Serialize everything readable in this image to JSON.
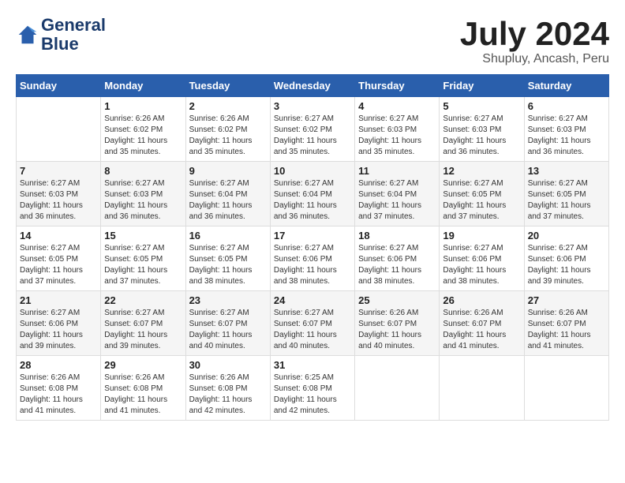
{
  "header": {
    "logo_line1": "General",
    "logo_line2": "Blue",
    "month_title": "July 2024",
    "subtitle": "Shupluy, Ancash, Peru"
  },
  "days_of_week": [
    "Sunday",
    "Monday",
    "Tuesday",
    "Wednesday",
    "Thursday",
    "Friday",
    "Saturday"
  ],
  "weeks": [
    [
      {
        "day": "",
        "sunrise": "",
        "sunset": "",
        "daylight": ""
      },
      {
        "day": "1",
        "sunrise": "Sunrise: 6:26 AM",
        "sunset": "Sunset: 6:02 PM",
        "daylight": "Daylight: 11 hours and 35 minutes."
      },
      {
        "day": "2",
        "sunrise": "Sunrise: 6:26 AM",
        "sunset": "Sunset: 6:02 PM",
        "daylight": "Daylight: 11 hours and 35 minutes."
      },
      {
        "day": "3",
        "sunrise": "Sunrise: 6:27 AM",
        "sunset": "Sunset: 6:02 PM",
        "daylight": "Daylight: 11 hours and 35 minutes."
      },
      {
        "day": "4",
        "sunrise": "Sunrise: 6:27 AM",
        "sunset": "Sunset: 6:03 PM",
        "daylight": "Daylight: 11 hours and 35 minutes."
      },
      {
        "day": "5",
        "sunrise": "Sunrise: 6:27 AM",
        "sunset": "Sunset: 6:03 PM",
        "daylight": "Daylight: 11 hours and 36 minutes."
      },
      {
        "day": "6",
        "sunrise": "Sunrise: 6:27 AM",
        "sunset": "Sunset: 6:03 PM",
        "daylight": "Daylight: 11 hours and 36 minutes."
      }
    ],
    [
      {
        "day": "7",
        "sunrise": "Sunrise: 6:27 AM",
        "sunset": "Sunset: 6:03 PM",
        "daylight": "Daylight: 11 hours and 36 minutes."
      },
      {
        "day": "8",
        "sunrise": "Sunrise: 6:27 AM",
        "sunset": "Sunset: 6:03 PM",
        "daylight": "Daylight: 11 hours and 36 minutes."
      },
      {
        "day": "9",
        "sunrise": "Sunrise: 6:27 AM",
        "sunset": "Sunset: 6:04 PM",
        "daylight": "Daylight: 11 hours and 36 minutes."
      },
      {
        "day": "10",
        "sunrise": "Sunrise: 6:27 AM",
        "sunset": "Sunset: 6:04 PM",
        "daylight": "Daylight: 11 hours and 36 minutes."
      },
      {
        "day": "11",
        "sunrise": "Sunrise: 6:27 AM",
        "sunset": "Sunset: 6:04 PM",
        "daylight": "Daylight: 11 hours and 37 minutes."
      },
      {
        "day": "12",
        "sunrise": "Sunrise: 6:27 AM",
        "sunset": "Sunset: 6:05 PM",
        "daylight": "Daylight: 11 hours and 37 minutes."
      },
      {
        "day": "13",
        "sunrise": "Sunrise: 6:27 AM",
        "sunset": "Sunset: 6:05 PM",
        "daylight": "Daylight: 11 hours and 37 minutes."
      }
    ],
    [
      {
        "day": "14",
        "sunrise": "Sunrise: 6:27 AM",
        "sunset": "Sunset: 6:05 PM",
        "daylight": "Daylight: 11 hours and 37 minutes."
      },
      {
        "day": "15",
        "sunrise": "Sunrise: 6:27 AM",
        "sunset": "Sunset: 6:05 PM",
        "daylight": "Daylight: 11 hours and 37 minutes."
      },
      {
        "day": "16",
        "sunrise": "Sunrise: 6:27 AM",
        "sunset": "Sunset: 6:05 PM",
        "daylight": "Daylight: 11 hours and 38 minutes."
      },
      {
        "day": "17",
        "sunrise": "Sunrise: 6:27 AM",
        "sunset": "Sunset: 6:06 PM",
        "daylight": "Daylight: 11 hours and 38 minutes."
      },
      {
        "day": "18",
        "sunrise": "Sunrise: 6:27 AM",
        "sunset": "Sunset: 6:06 PM",
        "daylight": "Daylight: 11 hours and 38 minutes."
      },
      {
        "day": "19",
        "sunrise": "Sunrise: 6:27 AM",
        "sunset": "Sunset: 6:06 PM",
        "daylight": "Daylight: 11 hours and 38 minutes."
      },
      {
        "day": "20",
        "sunrise": "Sunrise: 6:27 AM",
        "sunset": "Sunset: 6:06 PM",
        "daylight": "Daylight: 11 hours and 39 minutes."
      }
    ],
    [
      {
        "day": "21",
        "sunrise": "Sunrise: 6:27 AM",
        "sunset": "Sunset: 6:06 PM",
        "daylight": "Daylight: 11 hours and 39 minutes."
      },
      {
        "day": "22",
        "sunrise": "Sunrise: 6:27 AM",
        "sunset": "Sunset: 6:07 PM",
        "daylight": "Daylight: 11 hours and 39 minutes."
      },
      {
        "day": "23",
        "sunrise": "Sunrise: 6:27 AM",
        "sunset": "Sunset: 6:07 PM",
        "daylight": "Daylight: 11 hours and 40 minutes."
      },
      {
        "day": "24",
        "sunrise": "Sunrise: 6:27 AM",
        "sunset": "Sunset: 6:07 PM",
        "daylight": "Daylight: 11 hours and 40 minutes."
      },
      {
        "day": "25",
        "sunrise": "Sunrise: 6:26 AM",
        "sunset": "Sunset: 6:07 PM",
        "daylight": "Daylight: 11 hours and 40 minutes."
      },
      {
        "day": "26",
        "sunrise": "Sunrise: 6:26 AM",
        "sunset": "Sunset: 6:07 PM",
        "daylight": "Daylight: 11 hours and 41 minutes."
      },
      {
        "day": "27",
        "sunrise": "Sunrise: 6:26 AM",
        "sunset": "Sunset: 6:07 PM",
        "daylight": "Daylight: 11 hours and 41 minutes."
      }
    ],
    [
      {
        "day": "28",
        "sunrise": "Sunrise: 6:26 AM",
        "sunset": "Sunset: 6:08 PM",
        "daylight": "Daylight: 11 hours and 41 minutes."
      },
      {
        "day": "29",
        "sunrise": "Sunrise: 6:26 AM",
        "sunset": "Sunset: 6:08 PM",
        "daylight": "Daylight: 11 hours and 41 minutes."
      },
      {
        "day": "30",
        "sunrise": "Sunrise: 6:26 AM",
        "sunset": "Sunset: 6:08 PM",
        "daylight": "Daylight: 11 hours and 42 minutes."
      },
      {
        "day": "31",
        "sunrise": "Sunrise: 6:25 AM",
        "sunset": "Sunset: 6:08 PM",
        "daylight": "Daylight: 11 hours and 42 minutes."
      },
      {
        "day": "",
        "sunrise": "",
        "sunset": "",
        "daylight": ""
      },
      {
        "day": "",
        "sunrise": "",
        "sunset": "",
        "daylight": ""
      },
      {
        "day": "",
        "sunrise": "",
        "sunset": "",
        "daylight": ""
      }
    ]
  ]
}
